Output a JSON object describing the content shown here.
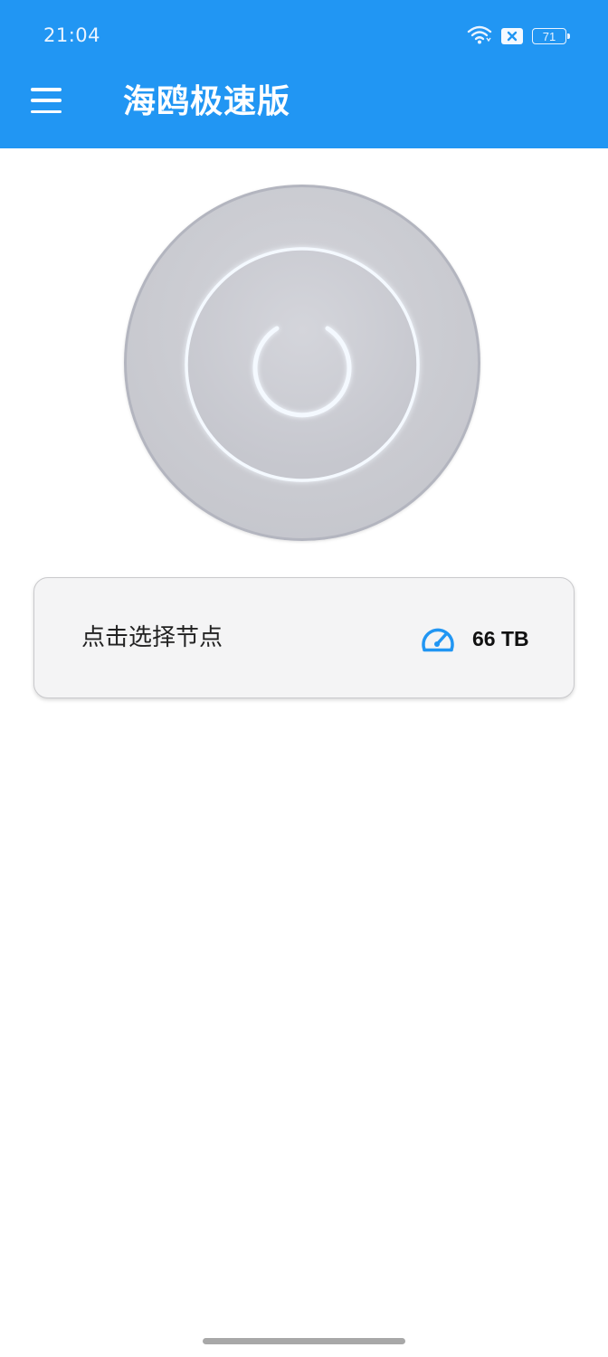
{
  "status_bar": {
    "time": "21:04",
    "battery": "71",
    "icons": [
      "wifi-icon",
      "sim-disabled-icon",
      "battery-icon"
    ]
  },
  "app_bar": {
    "title": "海鸥极速版",
    "menu_icon": "hamburger-menu-icon"
  },
  "power_button": {
    "icon": "power-icon",
    "state": "disconnected"
  },
  "node_card": {
    "label": "点击选择节点",
    "data_amount": "66 TB",
    "icon": "speedometer-icon"
  },
  "colors": {
    "primary": "#2196f3",
    "power_bg": "#c9cad0",
    "glow": "#eef6ff",
    "speed_icon": "#2196f3"
  }
}
